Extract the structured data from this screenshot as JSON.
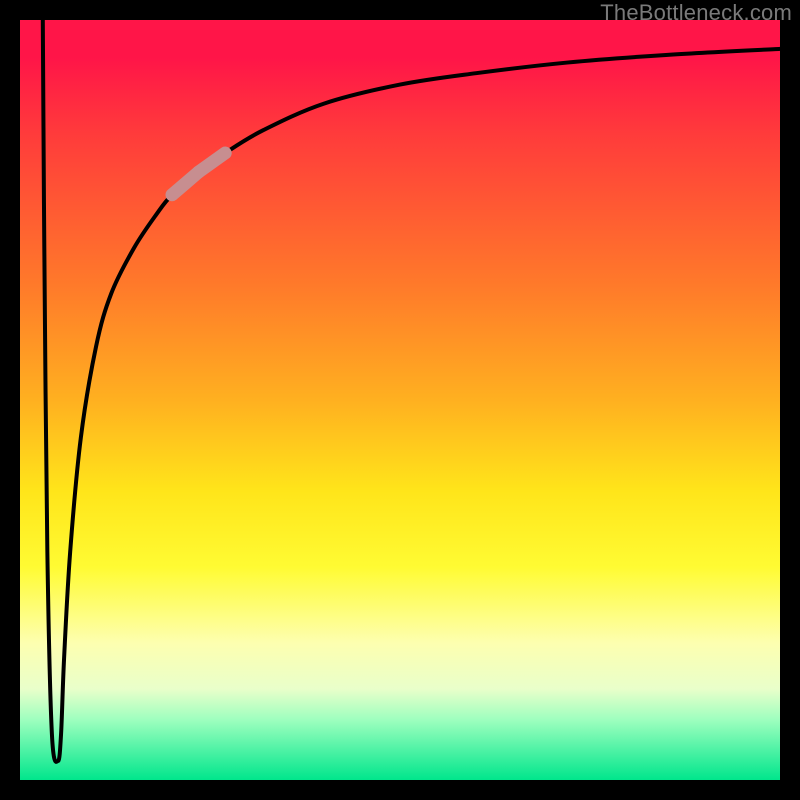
{
  "attribution": "TheBottleneck.com",
  "colors": {
    "page_bg": "#000000",
    "curve": "#000000",
    "highlight": "#c78e90",
    "gradient_top": "#ff1548",
    "gradient_bottom": "#00e68c"
  },
  "chart_data": {
    "type": "line",
    "title": "",
    "xlabel": "",
    "ylabel": "",
    "xlim": [
      0,
      100
    ],
    "ylim": [
      0,
      100
    ],
    "note": "Axes are unlabeled — values are pixel-space proportions read off the figure, 0–100 left→right / bottom→top.",
    "series": [
      {
        "name": "main-curve",
        "x": [
          3.0,
          3.2,
          3.6,
          4.2,
          5.0,
          5.4,
          5.8,
          6.6,
          8.0,
          10.0,
          12.0,
          15.0,
          18.0,
          20.0,
          23.5,
          27.0,
          32.0,
          40.0,
          50.0,
          60.0,
          72.0,
          85.0,
          100.0
        ],
        "y": [
          100,
          70,
          30,
          6,
          2.5,
          6,
          16,
          30,
          45,
          57,
          64,
          70,
          74.5,
          77,
          80,
          82.5,
          85.5,
          89,
          91.5,
          93,
          94.4,
          95.4,
          96.2
        ]
      }
    ],
    "highlights": [
      {
        "x_start": 20.0,
        "x_end": 23.5,
        "name": "highlight-a"
      },
      {
        "x_start": 23.5,
        "x_end": 27.0,
        "name": "highlight-b"
      }
    ]
  }
}
